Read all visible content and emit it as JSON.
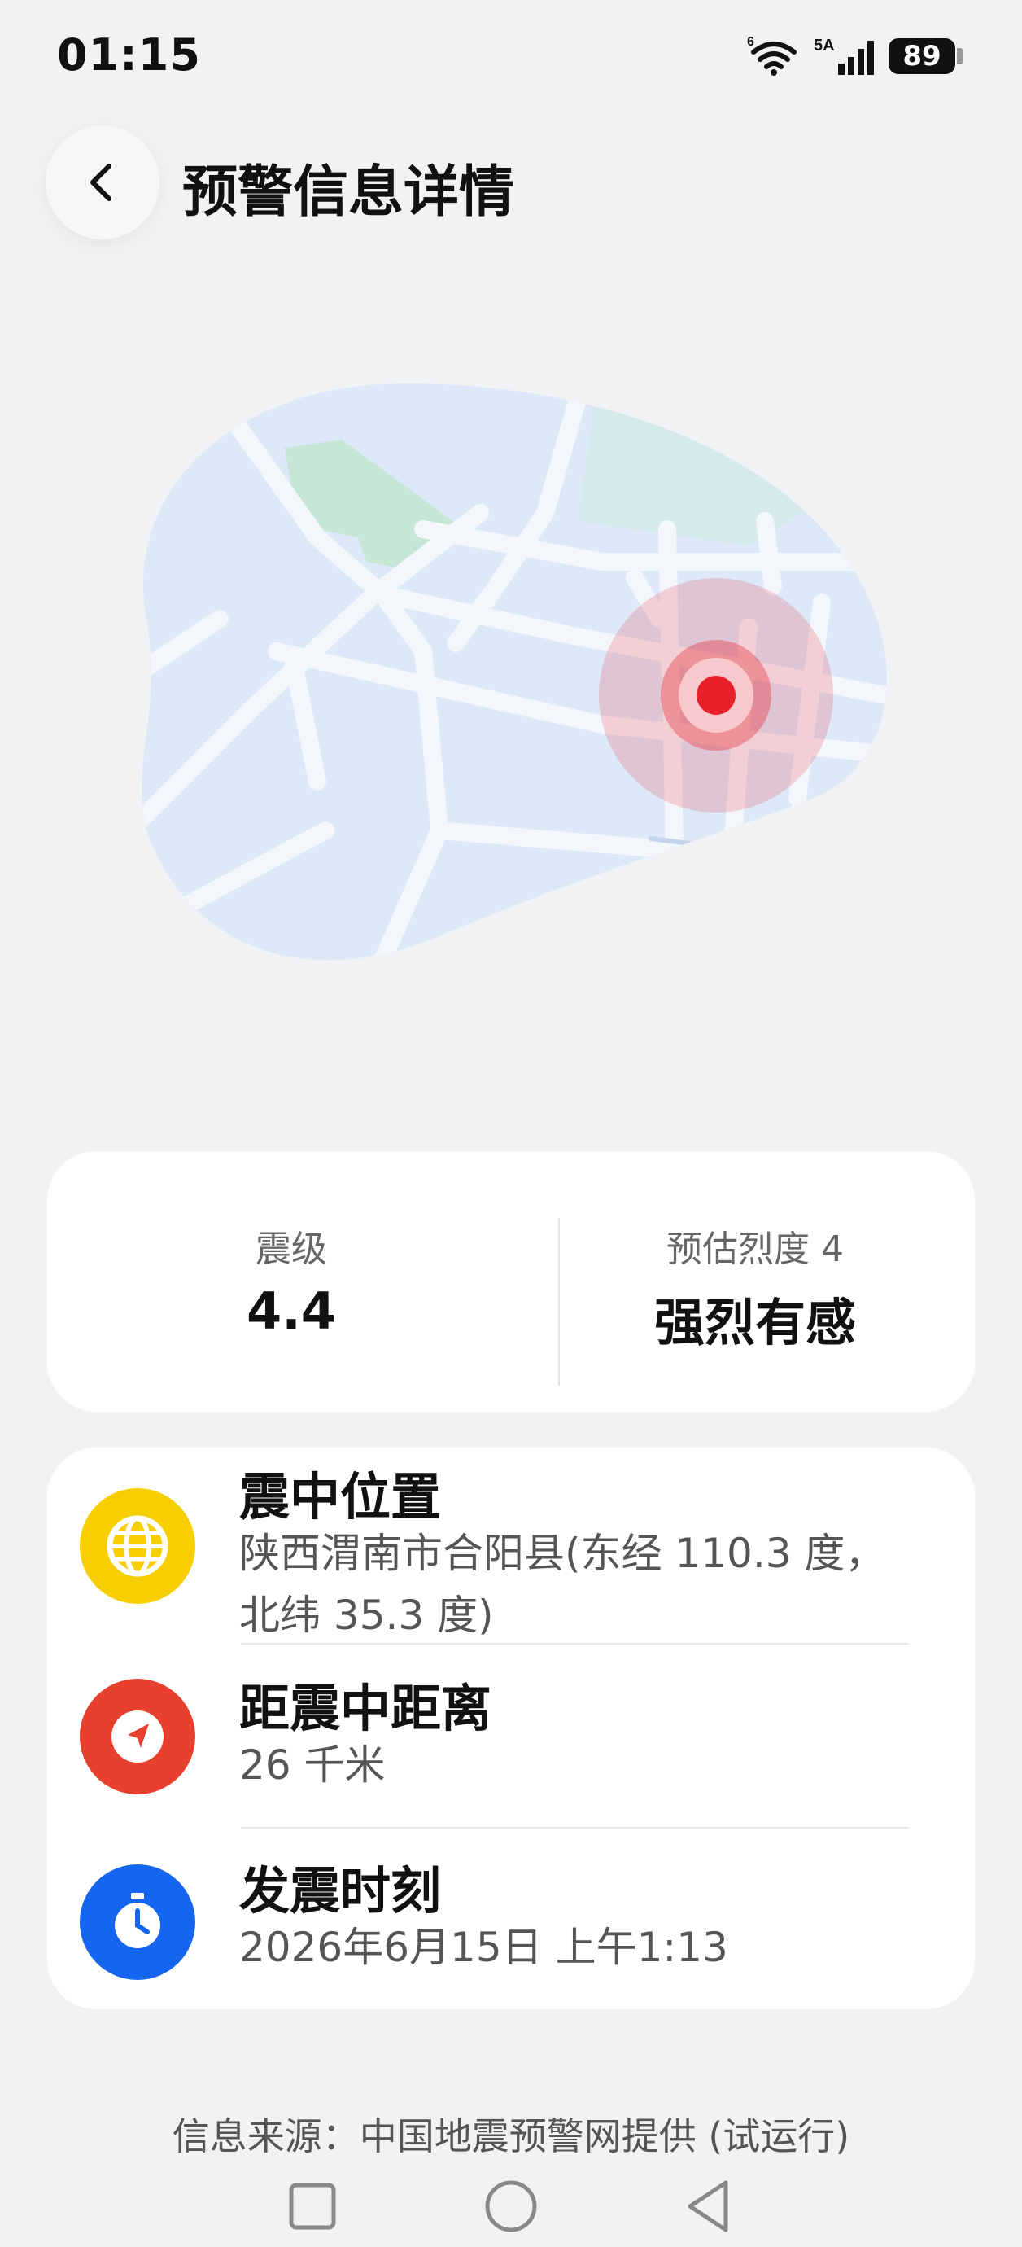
{
  "status_bar": {
    "time": "01:15",
    "wifi_label": "6",
    "signal_label": "5A",
    "battery": "89"
  },
  "header": {
    "title": "预警信息详情",
    "back_icon": "chevron-left-icon"
  },
  "map": {
    "epicenter_color": "#e8202a"
  },
  "magnitude": {
    "label": "震级",
    "value": "4.4",
    "intensity_label": "预估烈度 4",
    "intensity_value": "强烈有感"
  },
  "details": {
    "location": {
      "icon": "globe-icon",
      "color": "#f7cf00",
      "title": "震中位置",
      "value": "陕西渭南市合阳县(东经 110.3 度，北纬 35.3 度)"
    },
    "distance": {
      "icon": "navigation-arrow-icon",
      "color": "#e8402e",
      "title": "距震中距离",
      "value": "26 千米"
    },
    "time": {
      "icon": "stopwatch-icon",
      "color": "#1465f0",
      "title": "发震时刻",
      "value": "2026年6月15日 上午1:13"
    }
  },
  "footer": {
    "source": "信息来源：中国地震预警网提供 (试运行)"
  }
}
